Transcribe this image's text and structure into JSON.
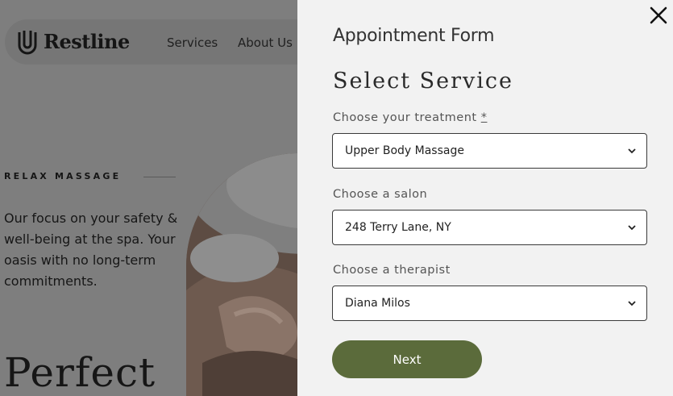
{
  "site": {
    "brand": "Restline",
    "nav": {
      "services": "Services",
      "about": "About Us"
    },
    "eyebrow": "RELAX MASSAGE",
    "intro": "Our focus on your safety & well-being at the spa. Your oasis with no long-term commitments.",
    "headline": "Perfect"
  },
  "form": {
    "title": "Appointment Form",
    "subtitle": "Select Service",
    "treatment": {
      "label": "Choose your treatment",
      "required_mark": "*",
      "value": "Upper Body Massage"
    },
    "salon": {
      "label": "Choose a salon",
      "value": "248 Terry Lane, NY"
    },
    "therapist": {
      "label": "Choose a therapist",
      "value": "Diana Milos"
    },
    "next_label": "Next"
  },
  "icons": {
    "close": "close-icon",
    "chevron": "chevron-down-icon",
    "logo": "logo-mark-icon"
  },
  "colors": {
    "accent": "#5b6b3b",
    "panel_bg": "#f2f2f2",
    "overlay": "#7e7e7e"
  }
}
